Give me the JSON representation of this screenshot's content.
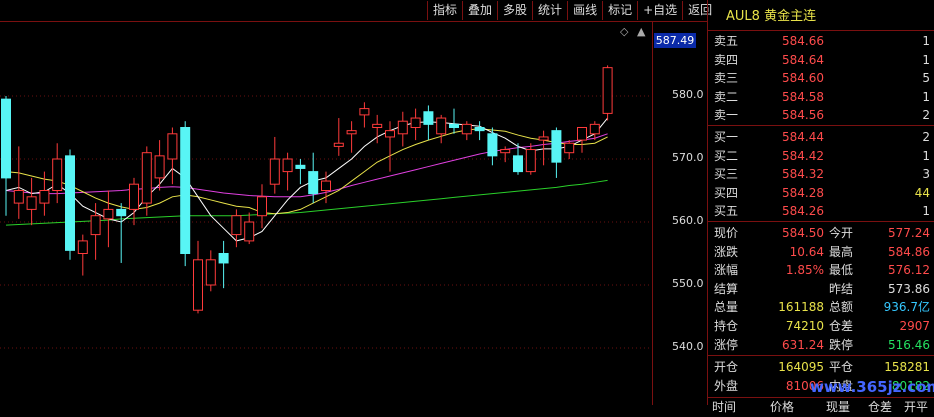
{
  "toolbar": {
    "items": [
      "指标",
      "叠加",
      "多股",
      "统计",
      "画线",
      "标记",
      "+自选",
      "返回"
    ]
  },
  "chart": {
    "current_price_tag": "587.49",
    "axis_labels": [
      "580.0",
      "570.0",
      "560.0",
      "550.0",
      "540.0"
    ],
    "colors": {
      "up": "#ff3b3b",
      "down": "#58f5f5",
      "ma5": "#ffffff",
      "ma10": "#e8e24a",
      "ma20": "#e040e0",
      "ma60": "#2ad02a"
    }
  },
  "chart_data": {
    "type": "candlestick",
    "ylim": [
      535,
      590
    ],
    "price_ticks": [
      580,
      570,
      560,
      550,
      540
    ],
    "candles": [
      {
        "o": 579.5,
        "h": 580.0,
        "l": 561.0,
        "c": 567.0
      },
      {
        "o": 563.0,
        "h": 572.0,
        "l": 560.5,
        "c": 565.0
      },
      {
        "o": 562.0,
        "h": 567.0,
        "l": 559.5,
        "c": 564.0
      },
      {
        "o": 563.0,
        "h": 568.0,
        "l": 561.0,
        "c": 565.0
      },
      {
        "o": 565.0,
        "h": 572.5,
        "l": 563.0,
        "c": 570.0
      },
      {
        "o": 570.5,
        "h": 571.5,
        "l": 554.0,
        "c": 555.5
      },
      {
        "o": 555.0,
        "h": 558.0,
        "l": 551.5,
        "c": 557.0
      },
      {
        "o": 558.0,
        "h": 563.0,
        "l": 554.0,
        "c": 561.0
      },
      {
        "o": 560.5,
        "h": 565.0,
        "l": 556.0,
        "c": 562.0
      },
      {
        "o": 562.0,
        "h": 563.0,
        "l": 553.5,
        "c": 561.0
      },
      {
        "o": 562.0,
        "h": 567.0,
        "l": 559.5,
        "c": 566.0
      },
      {
        "o": 563.0,
        "h": 572.0,
        "l": 561.0,
        "c": 571.0
      },
      {
        "o": 567.0,
        "h": 573.0,
        "l": 565.0,
        "c": 570.5
      },
      {
        "o": 570.0,
        "h": 575.0,
        "l": 566.0,
        "c": 574.0
      },
      {
        "o": 575.0,
        "h": 576.0,
        "l": 553.0,
        "c": 555.0
      },
      {
        "o": 546.0,
        "h": 557.0,
        "l": 545.5,
        "c": 554.0
      },
      {
        "o": 550.0,
        "h": 555.5,
        "l": 549.0,
        "c": 554.0
      },
      {
        "o": 555.0,
        "h": 557.0,
        "l": 549.5,
        "c": 553.5
      },
      {
        "o": 558.0,
        "h": 562.0,
        "l": 556.0,
        "c": 561.0
      },
      {
        "o": 557.0,
        "h": 561.5,
        "l": 556.5,
        "c": 560.0
      },
      {
        "o": 561.0,
        "h": 566.0,
        "l": 559.0,
        "c": 564.0
      },
      {
        "o": 566.0,
        "h": 573.5,
        "l": 564.5,
        "c": 570.0
      },
      {
        "o": 568.0,
        "h": 571.0,
        "l": 565.0,
        "c": 570.0
      },
      {
        "o": 569.0,
        "h": 570.0,
        "l": 566.0,
        "c": 568.5
      },
      {
        "o": 568.0,
        "h": 571.0,
        "l": 563.0,
        "c": 564.5
      },
      {
        "o": 565.0,
        "h": 568.0,
        "l": 563.0,
        "c": 566.5
      },
      {
        "o": 572.0,
        "h": 576.5,
        "l": 570.5,
        "c": 572.5
      },
      {
        "o": 574.0,
        "h": 576.0,
        "l": 571.0,
        "c": 574.5
      },
      {
        "o": 577.0,
        "h": 579.0,
        "l": 575.0,
        "c": 578.0
      },
      {
        "o": 575.0,
        "h": 577.0,
        "l": 572.5,
        "c": 575.5
      },
      {
        "o": 573.5,
        "h": 576.0,
        "l": 568.0,
        "c": 574.5
      },
      {
        "o": 574.0,
        "h": 577.5,
        "l": 572.0,
        "c": 576.0
      },
      {
        "o": 575.0,
        "h": 578.0,
        "l": 573.0,
        "c": 576.5
      },
      {
        "o": 577.5,
        "h": 578.5,
        "l": 573.0,
        "c": 575.5
      },
      {
        "o": 574.0,
        "h": 577.0,
        "l": 572.5,
        "c": 576.5
      },
      {
        "o": 575.5,
        "h": 578.0,
        "l": 574.0,
        "c": 575.0
      },
      {
        "o": 574.0,
        "h": 576.0,
        "l": 573.0,
        "c": 575.5
      },
      {
        "o": 575.0,
        "h": 576.0,
        "l": 573.0,
        "c": 574.5
      },
      {
        "o": 574.0,
        "h": 575.0,
        "l": 569.0,
        "c": 570.5
      },
      {
        "o": 571.0,
        "h": 572.0,
        "l": 569.5,
        "c": 571.5
      },
      {
        "o": 570.5,
        "h": 572.5,
        "l": 567.5,
        "c": 568.0
      },
      {
        "o": 568.0,
        "h": 572.5,
        "l": 567.5,
        "c": 571.5
      },
      {
        "o": 573.0,
        "h": 574.5,
        "l": 569.0,
        "c": 573.5
      },
      {
        "o": 574.5,
        "h": 575.0,
        "l": 567.0,
        "c": 569.5
      },
      {
        "o": 571.0,
        "h": 573.0,
        "l": 570.0,
        "c": 572.5
      },
      {
        "o": 573.0,
        "h": 575.0,
        "l": 571.0,
        "c": 575.0
      },
      {
        "o": 574.0,
        "h": 576.0,
        "l": 573.0,
        "c": 575.5
      },
      {
        "o": 577.24,
        "h": 584.86,
        "l": 576.12,
        "c": 584.5
      }
    ],
    "ma5": [
      565,
      565.5,
      564.5,
      564.8,
      566,
      564.5,
      562.5,
      561.5,
      560.5,
      560,
      561.5,
      564,
      566,
      568.5,
      567,
      564,
      561,
      559,
      557,
      557.5,
      558.5,
      561,
      563.5,
      565.5,
      566.5,
      567,
      568.5,
      570,
      572,
      573.5,
      574.5,
      575.3,
      575.8,
      575.9,
      575.8,
      575.6,
      575.4,
      575.2,
      574.2,
      573.3,
      572,
      571.3,
      571.6,
      571.6,
      572,
      573,
      574,
      576.5
    ],
    "ma10": [
      568,
      567.8,
      567.3,
      566.8,
      566.5,
      565.8,
      564.8,
      563.8,
      563,
      562.4,
      562,
      562.3,
      563,
      564,
      564.3,
      564,
      563.5,
      563,
      562.5,
      562.3,
      561.5,
      561.3,
      561.5,
      562,
      563,
      564,
      565,
      566.5,
      568,
      569.5,
      570.5,
      571.5,
      572.3,
      573,
      573.6,
      574.2,
      574.6,
      574.8,
      574.6,
      574.4,
      573.8,
      573.3,
      573,
      572.6,
      572.3,
      572.3,
      572.5,
      573.5
    ],
    "ma20": [
      565,
      564.8,
      564.6,
      564.5,
      564.5,
      564.6,
      564.7,
      564.8,
      564.9,
      565,
      565.2,
      565.3,
      565.5,
      565.6,
      565.5,
      565.2,
      564.9,
      564.6,
      564.4,
      564.2,
      564.1,
      564,
      564,
      564,
      564.3,
      564.7,
      565.2,
      565.8,
      566.3,
      566.8,
      567.3,
      567.8,
      568.3,
      568.8,
      569.3,
      569.8,
      570.3,
      570.8,
      571.2,
      571.5,
      571.8,
      572,
      572.3,
      572.5,
      572.8,
      573,
      573.3,
      574
    ],
    "ma60": [
      559.5,
      559.6,
      559.7,
      559.8,
      559.9,
      560,
      560.1,
      560.2,
      560.3,
      560.5,
      560.6,
      560.7,
      560.8,
      560.9,
      561,
      561,
      561,
      561,
      561,
      561.1,
      561.2,
      561.3,
      561.4,
      561.5,
      561.7,
      561.9,
      562.1,
      562.3,
      562.5,
      562.7,
      562.9,
      563.1,
      563.3,
      563.5,
      563.7,
      563.9,
      564.1,
      564.3,
      564.5,
      564.7,
      564.9,
      565.1,
      565.3,
      565.5,
      565.8,
      566,
      566.3,
      566.6
    ]
  },
  "panel": {
    "code": "AUL8",
    "name": "黄金主连",
    "asks": [
      {
        "label": "卖五",
        "price": "584.66",
        "vol": "1"
      },
      {
        "label": "卖四",
        "price": "584.64",
        "vol": "1"
      },
      {
        "label": "卖三",
        "price": "584.60",
        "vol": "5"
      },
      {
        "label": "卖二",
        "price": "584.58",
        "vol": "1"
      },
      {
        "label": "卖一",
        "price": "584.56",
        "vol": "2"
      }
    ],
    "bids": [
      {
        "label": "买一",
        "price": "584.44",
        "vol": "2"
      },
      {
        "label": "买二",
        "price": "584.42",
        "vol": "1"
      },
      {
        "label": "买三",
        "price": "584.32",
        "vol": "3"
      },
      {
        "label": "买四",
        "price": "584.28",
        "vol": "44"
      },
      {
        "label": "买五",
        "price": "584.26",
        "vol": "1"
      }
    ],
    "stats": [
      {
        "l1": "现价",
        "v1": "584.50",
        "c1": "red",
        "l2": "今开",
        "v2": "577.24",
        "c2": "red"
      },
      {
        "l1": "涨跌",
        "v1": "10.64",
        "c1": "red",
        "l2": "最高",
        "v2": "584.86",
        "c2": "red"
      },
      {
        "l1": "涨幅",
        "v1": "1.85%",
        "c1": "red",
        "l2": "最低",
        "v2": "576.12",
        "c2": "red"
      },
      {
        "l1": "结算",
        "v1": "",
        "c1": "white",
        "l2": "昨结",
        "v2": "573.86",
        "c2": "white"
      },
      {
        "l1": "总量",
        "v1": "161188",
        "c1": "yellow",
        "l2": "总额",
        "v2": "936.7亿",
        "c2": "cyan"
      },
      {
        "l1": "持仓",
        "v1": "74210",
        "c1": "yellow",
        "l2": "仓差",
        "v2": "2907",
        "c2": "red"
      },
      {
        "l1": "涨停",
        "v1": "631.24",
        "c1": "red",
        "l2": "跌停",
        "v2": "516.46",
        "c2": "green"
      }
    ],
    "bottom": [
      {
        "l1": "开仓",
        "v1": "164095",
        "c1": "yellow",
        "l2": "平仓",
        "v2": "158281",
        "c2": "yellow"
      },
      {
        "l1": "外盘",
        "v1": "81006",
        "c1": "red",
        "l2": "内盘",
        "v2": "80182",
        "c2": "green"
      }
    ],
    "footer": [
      "时间",
      "价格",
      "现量",
      "仓差",
      "开平"
    ],
    "watermark": "www.365jz.com"
  }
}
